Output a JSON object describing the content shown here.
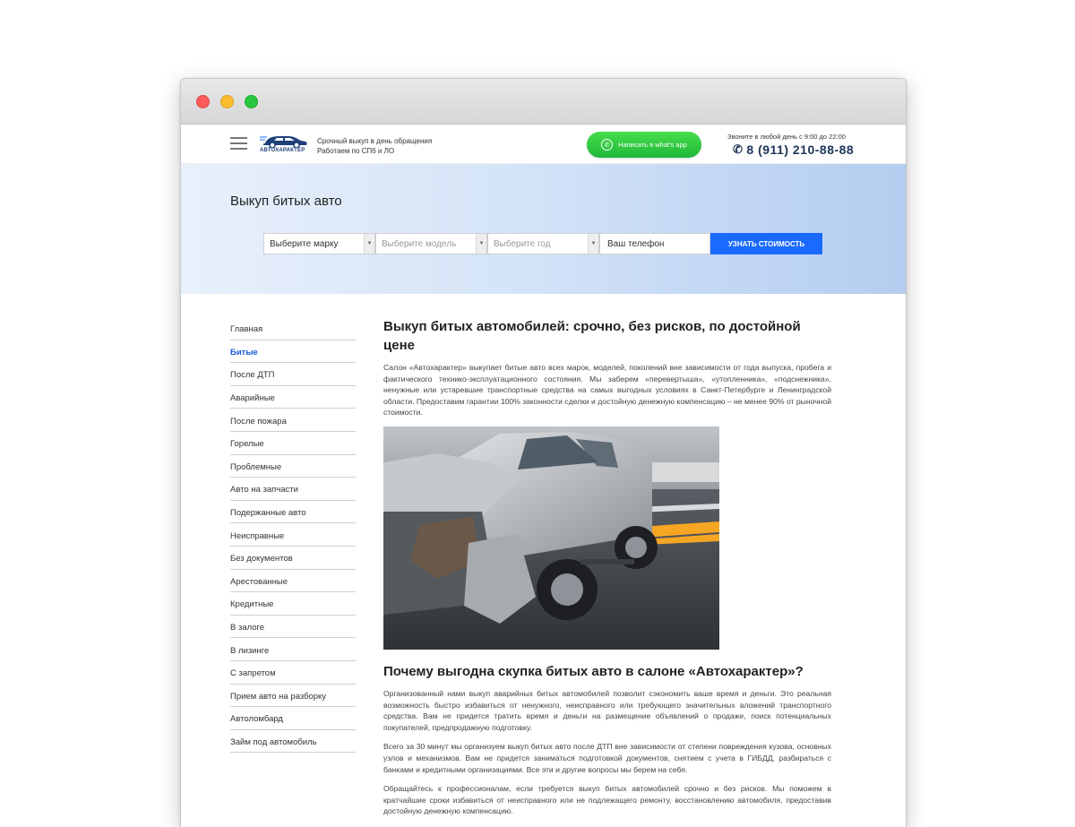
{
  "header": {
    "logo_text": "АВТОХАРАКТЕР",
    "tagline_line1": "Срочный выкуп в день обращения",
    "tagline_line2": "Работаем по СПб и ЛО",
    "whatsapp_label": "Написать в what's app",
    "call_hint": "Звоните в любой день с 9:00 до 22:00",
    "phone": "8 (911) 210-88-88"
  },
  "hero": {
    "title": "Выкуп битых авто",
    "brand_select": "Выберите марку",
    "model_select": "Выберите модель",
    "year_select": "Выберите год",
    "phone_placeholder": "Ваш телефон",
    "submit_label": "УЗНАТЬ СТОИМОСТЬ"
  },
  "sidebar": {
    "items": [
      {
        "label": "Главная"
      },
      {
        "label": "Битые"
      },
      {
        "label": "После ДТП"
      },
      {
        "label": "Аварийные"
      },
      {
        "label": "После пожара"
      },
      {
        "label": "Горелые"
      },
      {
        "label": "Проблемные"
      },
      {
        "label": "Авто на запчасти"
      },
      {
        "label": "Подержанные авто"
      },
      {
        "label": "Неисправные"
      },
      {
        "label": "Без документов"
      },
      {
        "label": "Арестованные"
      },
      {
        "label": "Кредитные"
      },
      {
        "label": "В залоге"
      },
      {
        "label": "В лизинге"
      },
      {
        "label": "С запретом"
      },
      {
        "label": "Прием авто на разборку"
      },
      {
        "label": "Автоломбард"
      },
      {
        "label": "Займ под автомобиль"
      }
    ],
    "active_index": 1
  },
  "article": {
    "h1": "Выкуп битых автомобилей: срочно, без рисков, по достойной цене",
    "p1": "Салон «Автохарактер» выкупает битые авто всех марок, моделей, поколений вне зависимости от года выпуска, пробега и фактического технико-эксплуатационного состояния. Мы заберем «перевертыша», «утопленника», «подснежника», ненужные или устаревшие транспортные средства на самых выгодных условиях в Санкт-Петербурге и Ленинградской области. Предоставим гарантии 100% законности сделки и достойную денежную компенсацию – не менее 90% от рыночной стоимости.",
    "h2": "Почему выгодна скупка битых авто в салоне «Автохарактер»?",
    "p2": "Организованный нами выкуп аварийных битых автомобилей позволит сэкономить ваше время и деньги. Это реальная возможность быстро избавиться от ненужного, неисправного или требующего значительных вложений транспортного средства. Вам не придется тратить время и деньги на размещение объявлений о продаже, поиск потенциальных покупателей, предпродажную подготовку.",
    "p3": "Всего за 30 минут мы организуем выкуп битых авто после ДТП вне зависимости от степени повреждения кузова, основных узлов и механизмов. Вам не придется заниматься подготовкой документов, снятием с учета в ГИБДД, разбираться с банками и кредитными организациями. Все эти и другие вопросы мы берем на себя.",
    "p4": "Обращайтесь к профессионалам, если требуется выкуп битых автомобилей срочно и без рисков. Мы поможем в кратчайшие сроки избавиться от неисправного или не подлежащего ремонту, восстановлению автомобиля, предоставив достойную денежную компенсацию."
  },
  "colors": {
    "accent": "#1a6aff",
    "whatsapp": "#2ec44a",
    "active_nav": "#1a5cd6"
  }
}
